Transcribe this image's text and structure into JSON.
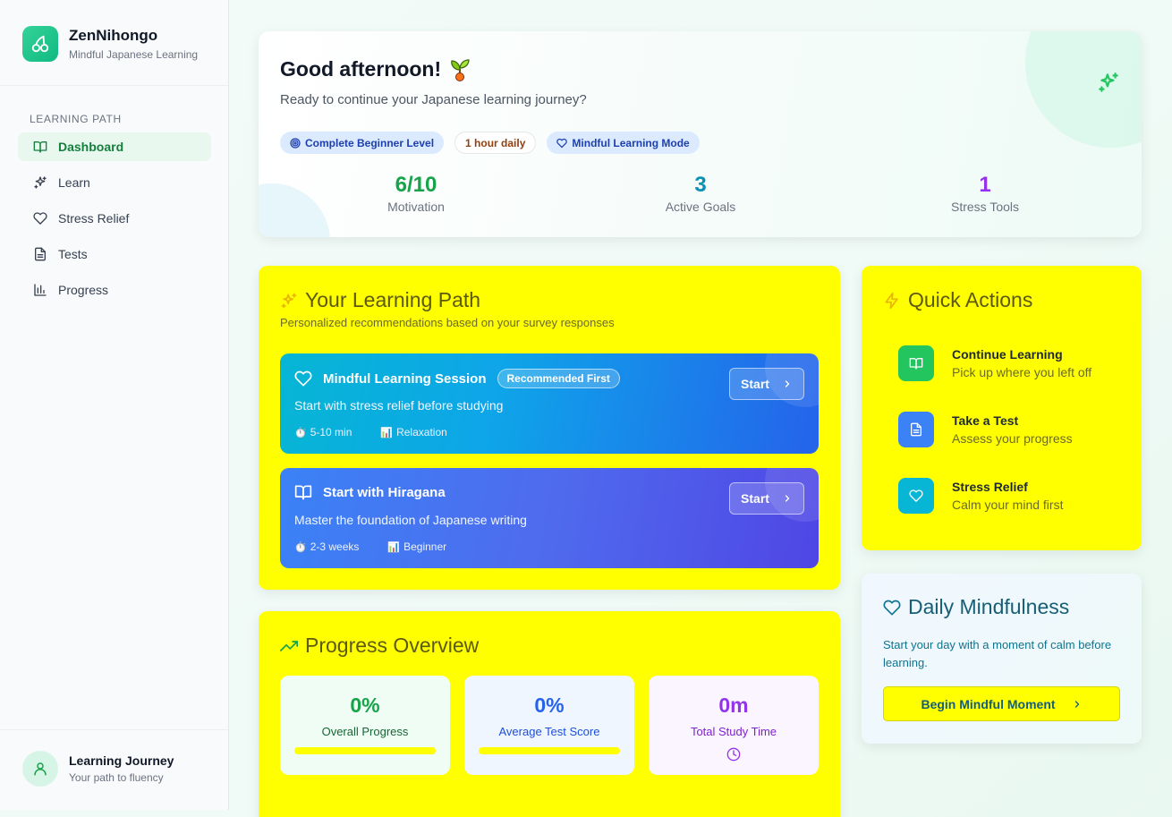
{
  "brand": {
    "name": "ZenNihongo",
    "subtitle": "Mindful Japanese Learning",
    "logo_icon": "cherries-icon"
  },
  "sidebar": {
    "section_label": "LEARNING PATH",
    "items": [
      {
        "label": "Dashboard",
        "icon": "book-open-icon",
        "active": true
      },
      {
        "label": "Learn",
        "icon": "sparkles-icon",
        "active": false
      },
      {
        "label": "Stress Relief",
        "icon": "heart-icon",
        "active": false
      },
      {
        "label": "Tests",
        "icon": "file-text-icon",
        "active": false
      },
      {
        "label": "Progress",
        "icon": "bar-chart-icon",
        "active": false
      }
    ],
    "footer": {
      "title": "Learning Journey",
      "subtitle": "Your path to fluency",
      "icon": "user-icon"
    }
  },
  "greeting": {
    "title": "Good afternoon!",
    "emoji": "🌱",
    "subtitle": "Ready to continue your Japanese learning journey?",
    "chips": [
      "Complete Beginner Level",
      "1 hour daily",
      "Mindful Learning Mode"
    ],
    "stats": [
      {
        "value": "6/10",
        "label": "Motivation",
        "color": "#16a34a"
      },
      {
        "value": "3",
        "label": "Active Goals",
        "color": "#0891b2"
      },
      {
        "value": "1",
        "label": "Stress Tools",
        "color": "#9333ea"
      }
    ]
  },
  "learning_path": {
    "title": "Your Learning Path",
    "subtitle": "Personalized recommendations based on your survey responses",
    "recommendations": [
      {
        "title": "Mindful Learning Session",
        "badge": "Recommended First",
        "description": "Start with stress relief before studying",
        "duration": "5-10 min",
        "category": "Relaxation",
        "button": "Start",
        "icon": "heart-icon"
      },
      {
        "title": "Start with Hiragana",
        "badge": "",
        "description": "Master the foundation of Japanese writing",
        "duration": "2-3 weeks",
        "category": "Beginner",
        "button": "Start",
        "icon": "book-open-icon"
      }
    ]
  },
  "quick_actions": {
    "title": "Quick Actions",
    "items": [
      {
        "title": "Continue Learning",
        "subtitle": "Pick up where you left off",
        "icon": "book-open-icon",
        "color": "#22c55e"
      },
      {
        "title": "Take a Test",
        "subtitle": "Assess your progress",
        "icon": "file-text-icon",
        "color": "#3b82f6"
      },
      {
        "title": "Stress Relief",
        "subtitle": "Calm your mind first",
        "icon": "heart-icon",
        "color": "#06b6d4"
      }
    ]
  },
  "mindfulness": {
    "title": "Daily Mindfulness",
    "description": "Start your day with a moment of calm before learning.",
    "button": "Begin Mindful Moment"
  },
  "progress": {
    "title": "Progress Overview",
    "boxes": [
      {
        "value": "0%",
        "label": "Overall Progress",
        "color": "#16a34a",
        "fill": 0
      },
      {
        "value": "0%",
        "label": "Average Test Score",
        "color": "#2563eb",
        "fill": 0
      },
      {
        "value": "0m",
        "label": "Total Study Time",
        "color": "#9333ea"
      }
    ]
  }
}
